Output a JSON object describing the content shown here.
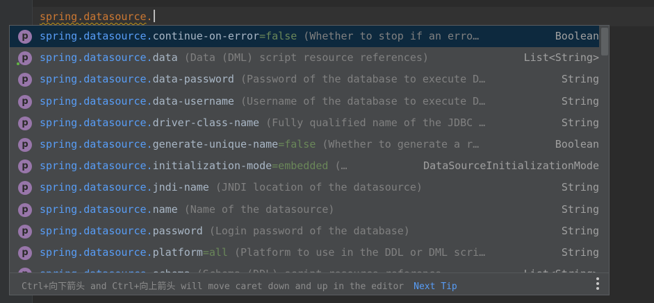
{
  "editor": {
    "typed_key": "spring.datasource",
    "typed_dot": "."
  },
  "completion": {
    "icon_letter": "p",
    "items": [
      {
        "prefix": "spring.datasource.",
        "name": "continue-on-error",
        "default": "=false",
        "desc": " (Whether to stop if an erro…",
        "type": "Boolean"
      },
      {
        "prefix": "spring.datasource.",
        "name": "data",
        "default": "",
        "desc": " (Data (DML) script resource references)",
        "type": "List<String>"
      },
      {
        "prefix": "spring.datasource.",
        "name": "data-password",
        "default": "",
        "desc": " (Password of the database to execute D…",
        "type": "String"
      },
      {
        "prefix": "spring.datasource.",
        "name": "data-username",
        "default": "",
        "desc": " (Username of the database to execute D…",
        "type": "String"
      },
      {
        "prefix": "spring.datasource.",
        "name": "driver-class-name",
        "default": "",
        "desc": " (Fully qualified name of the JDBC …",
        "type": "String"
      },
      {
        "prefix": "spring.datasource.",
        "name": "generate-unique-name",
        "default": "=false",
        "desc": " (Whether to generate a r…",
        "type": "Boolean"
      },
      {
        "prefix": "spring.datasource.",
        "name": "initialization-mode",
        "default": "=embedded",
        "desc": " (…",
        "type": "DataSourceInitializationMode"
      },
      {
        "prefix": "spring.datasource.",
        "name": "jndi-name",
        "default": "",
        "desc": " (JNDI location of the datasource)",
        "type": "String"
      },
      {
        "prefix": "spring.datasource.",
        "name": "name",
        "default": "",
        "desc": " (Name of the datasource)",
        "type": "String"
      },
      {
        "prefix": "spring.datasource.",
        "name": "password",
        "default": "",
        "desc": " (Login password of the database)",
        "type": "String"
      },
      {
        "prefix": "spring.datasource.",
        "name": "platform",
        "default": "=all",
        "desc": " (Platform to use in the DDL or DML scri…",
        "type": "String"
      },
      {
        "prefix": "spring.datasource.",
        "name": "schema",
        "default": "",
        "desc": " (Schema (DDL) script resource reference…",
        "type": "List<String>"
      }
    ]
  },
  "footer": {
    "hint": "Ctrl+向下箭头 and Ctrl+向上箭头 will move caret down and up in the editor",
    "next_tip": "Next Tip"
  },
  "colors": {
    "prefix": "#589df6",
    "selection": "#0d293e",
    "property_icon": "#9876aa",
    "default_value": "#6a8759"
  }
}
